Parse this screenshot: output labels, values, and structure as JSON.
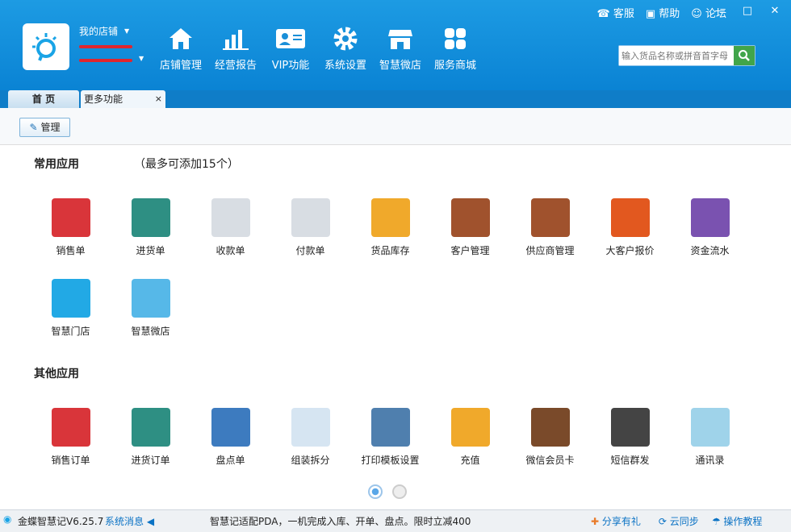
{
  "store": {
    "name": "我的店铺"
  },
  "nav": [
    {
      "label": "店铺管理",
      "icon": "home-icon"
    },
    {
      "label": "经营报告",
      "icon": "bar-chart-icon"
    },
    {
      "label": "VIP功能",
      "icon": "vip-card-icon"
    },
    {
      "label": "系统设置",
      "icon": "gear-icon"
    },
    {
      "label": "智慧微店",
      "icon": "shop-icon"
    },
    {
      "label": "服务商城",
      "icon": "grid-icon"
    }
  ],
  "top": {
    "service": "客服",
    "help": "帮助",
    "forum": "论坛"
  },
  "search": {
    "placeholder": "输入货品名称或拼音首字母"
  },
  "tabs": {
    "home": "首 页",
    "more": "更多功能",
    "close": "×"
  },
  "toolbar": {
    "manage": "管理"
  },
  "common": {
    "title": "常用应用",
    "note": "（最多可添加15个）",
    "apps": [
      {
        "label": "销售单",
        "color": "#d9353a"
      },
      {
        "label": "进货单",
        "color": "#2e8f83"
      },
      {
        "label": "收款单",
        "color": "#d8dde3"
      },
      {
        "label": "付款单",
        "color": "#d8dde3"
      },
      {
        "label": "货品库存",
        "color": "#f0a92b"
      },
      {
        "label": "客户管理",
        "color": "#a0522d"
      },
      {
        "label": "供应商管理",
        "color": "#a0522d"
      },
      {
        "label": "大客户报价",
        "color": "#e2581f"
      },
      {
        "label": "资金流水",
        "color": "#7a52b0"
      },
      {
        "label": "智慧门店",
        "color": "#22a9e5"
      },
      {
        "label": "智慧微店",
        "color": "#56b8e8"
      }
    ]
  },
  "other": {
    "title": "其他应用",
    "apps": [
      {
        "label": "销售订单",
        "color": "#d9353a"
      },
      {
        "label": "进货订单",
        "color": "#2e8f83"
      },
      {
        "label": "盘点单",
        "color": "#3d7bbf"
      },
      {
        "label": "组装拆分",
        "color": "#d6e5f2"
      },
      {
        "label": "打印模板设置",
        "color": "#4f7fae"
      },
      {
        "label": "充值",
        "color": "#f0a92b"
      },
      {
        "label": "微信会员卡",
        "color": "#7a4a2a"
      },
      {
        "label": "短信群发",
        "color": "#444444"
      },
      {
        "label": "通讯录",
        "color": "#9fd3ea"
      }
    ]
  },
  "status": {
    "version": "金蝶智慧记V6.25.7",
    "msg": "系统消息",
    "notice": "智慧记适配PDA，一机完成入库、开单、盘点。限时立减400",
    "share": "分享有礼",
    "cloud": "云同步",
    "tutorial": "操作教程"
  }
}
